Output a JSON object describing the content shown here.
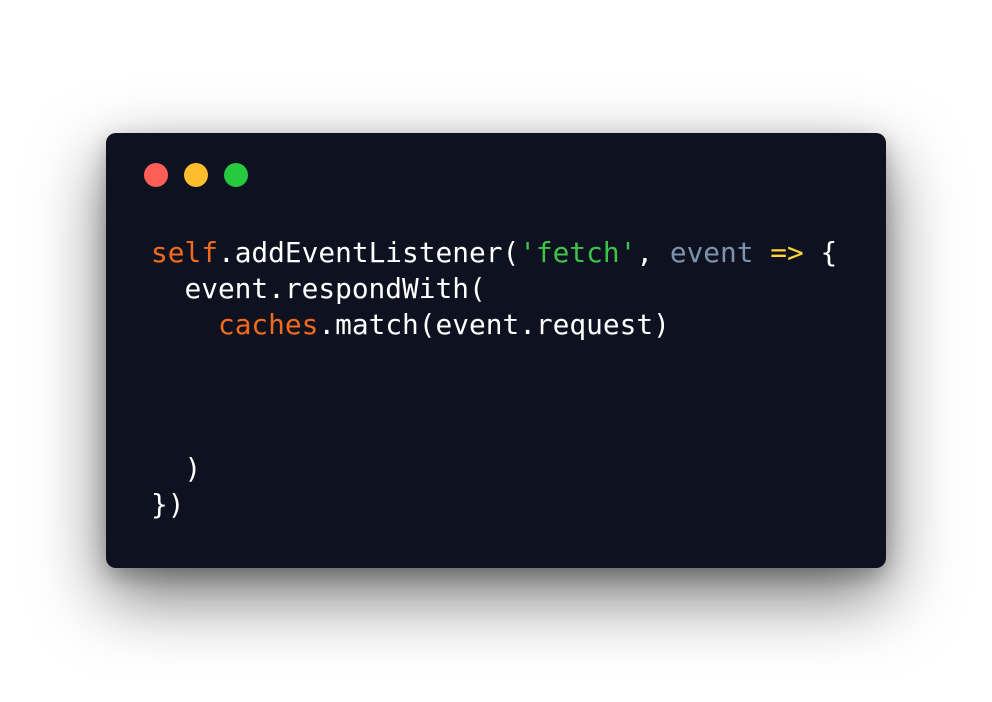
{
  "colors": {
    "background": "#0d1120",
    "close": "#ff5f56",
    "minimize": "#ffbd2e",
    "maximize": "#27c93f",
    "plain": "#ffffff",
    "keyword": "#f26b1d",
    "string": "#3ec24a",
    "param": "#7d92ad",
    "arrow": "#ffd43b"
  },
  "window_controls": [
    "close",
    "minimize",
    "maximize"
  ],
  "code_lines": [
    [
      {
        "text": "self",
        "role": "keyword"
      },
      {
        "text": ".addEventListener(",
        "role": "plain"
      },
      {
        "text": "'fetch'",
        "role": "string"
      },
      {
        "text": ", ",
        "role": "plain"
      },
      {
        "text": "event",
        "role": "param"
      },
      {
        "text": " ",
        "role": "plain"
      },
      {
        "text": "=>",
        "role": "arrow"
      },
      {
        "text": " {",
        "role": "plain"
      }
    ],
    [
      {
        "text": "  event.respondWith(",
        "role": "plain"
      }
    ],
    [
      {
        "text": "    ",
        "role": "plain"
      },
      {
        "text": "caches",
        "role": "keyword"
      },
      {
        "text": ".match(event.request)",
        "role": "plain"
      }
    ],
    [],
    [],
    [],
    [
      {
        "text": "  )",
        "role": "plain"
      }
    ],
    [
      {
        "text": "})",
        "role": "plain"
      }
    ]
  ]
}
